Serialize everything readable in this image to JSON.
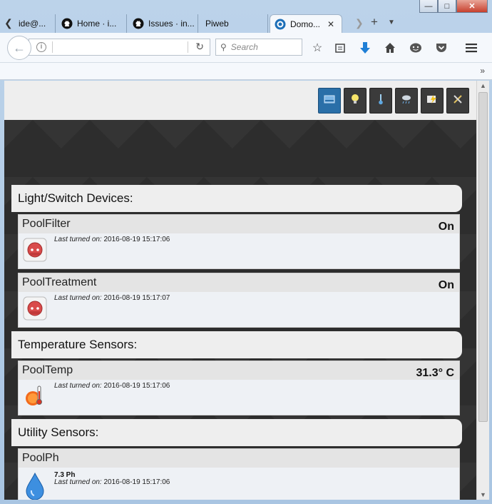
{
  "browser": {
    "tabs": [
      {
        "label": "ide@...",
        "icon": "generic-icon"
      },
      {
        "label": "Home · i...",
        "icon": "github-icon"
      },
      {
        "label": "Issues · in...",
        "icon": "github-icon"
      },
      {
        "label": "Piweb",
        "icon": "none"
      },
      {
        "label": "Domo...",
        "icon": "domoticz-icon",
        "active": true
      }
    ],
    "search_placeholder": "Search",
    "url_value": ""
  },
  "nav_buttons": [
    {
      "name": "dashboard",
      "icon": "dashboard-icon",
      "active": true
    },
    {
      "name": "lights",
      "icon": "bulb-icon",
      "active": false
    },
    {
      "name": "temperature",
      "icon": "thermometer-icon",
      "active": false
    },
    {
      "name": "weather",
      "icon": "cloud-rain-icon",
      "active": false
    },
    {
      "name": "utility",
      "icon": "utility-icon",
      "active": false
    },
    {
      "name": "setup",
      "icon": "tools-icon",
      "active": false
    }
  ],
  "sections": {
    "lights": {
      "title": "Light/Switch Devices:"
    },
    "temps": {
      "title": "Temperature Sensors:"
    },
    "utility": {
      "title": "Utility Sensors:"
    }
  },
  "devices": [
    {
      "name": "PoolFilter",
      "status": "On",
      "last_label": "Last turned on:",
      "last_value": "2016-08-19 15:17:06",
      "icon": "wall-socket-icon"
    },
    {
      "name": "PoolTreatment",
      "status": "On",
      "last_label": "Last turned on:",
      "last_value": "2016-08-19 15:17:07",
      "icon": "wall-socket-icon"
    },
    {
      "name": "PoolTemp",
      "status": "31.3° C",
      "last_label": "Last turned on:",
      "last_value": "2016-08-19 15:17:06",
      "icon": "thermometer-sun-icon"
    },
    {
      "name": "PoolPh",
      "status": "",
      "reading": "7.3 Ph",
      "last_label": "Last turned on:",
      "last_value": "2016-08-19 15:17:06",
      "icon": "water-drop-icon"
    }
  ],
  "colors": {
    "accent": "#2a6fa8",
    "dark_bg": "#2d2d2d",
    "card_bg": "#eef1f5"
  }
}
